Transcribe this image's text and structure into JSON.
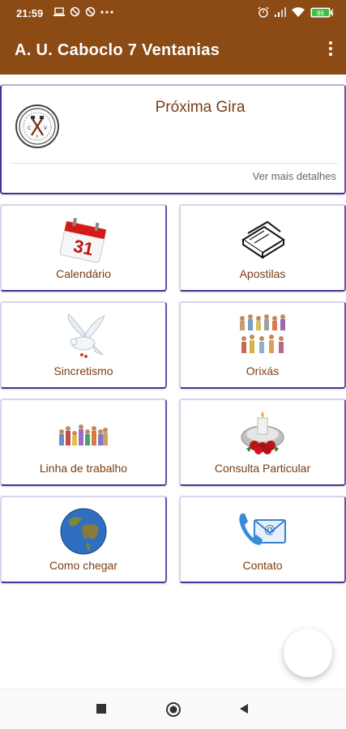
{
  "status_bar": {
    "time": "21:59",
    "icons_left": [
      "laptop-icon",
      "no-sign-icon",
      "no-sign-icon",
      "more-dots-icon"
    ],
    "icons_right": [
      "alarm-icon",
      "signal-icon",
      "wifi-icon",
      "battery-icon"
    ],
    "battery_level": "86"
  },
  "app_bar": {
    "title": "A. U. Caboclo 7 Ventanias",
    "menu_icon": "overflow-menu-icon"
  },
  "next_gira": {
    "title": "Próxima Gira",
    "details_link": "Ver mais detalhes",
    "logo_icon": "temple-logo-icon"
  },
  "menu": [
    {
      "label": "Calendário",
      "icon": "calendar-icon"
    },
    {
      "label": "Apostilas",
      "icon": "books-icon"
    },
    {
      "label": "Sincretismo",
      "icon": "dove-icon"
    },
    {
      "label": "Orixás",
      "icon": "orixas-figures-icon"
    },
    {
      "label": "Linha de trabalho",
      "icon": "work-line-figures-icon"
    },
    {
      "label": "Consulta Particular",
      "icon": "candle-roses-icon"
    },
    {
      "label": "Como chegar",
      "icon": "globe-icon"
    },
    {
      "label": "Contato",
      "icon": "contact-phone-mail-icon"
    }
  ],
  "colors": {
    "app_bar": "#8c4a14",
    "label_text": "#7a3d12",
    "card_border": "#4c2f9a"
  },
  "nav_bar": {
    "buttons": [
      "recents-square-icon",
      "home-circle-icon",
      "back-triangle-icon"
    ]
  }
}
